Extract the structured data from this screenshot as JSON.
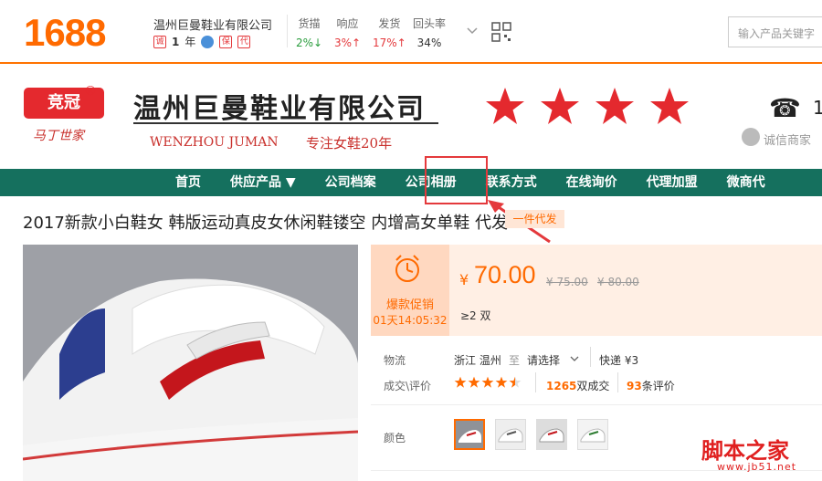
{
  "topbar": {
    "logo": "1688",
    "company": "温州巨曼鞋业有限公司",
    "years_num": "1",
    "years_unit": "年",
    "stats": [
      {
        "label": "货描",
        "value": "2%↓",
        "color": "green"
      },
      {
        "label": "响应",
        "value": "3%↑",
        "color": "red"
      },
      {
        "label": "发货",
        "value": "17%↑",
        "color": "red"
      },
      {
        "label": "回头率",
        "value": "34%",
        "color": "dark"
      }
    ],
    "search_placeholder": "输入产品关键字"
  },
  "banner": {
    "brand_logo": "竞冠",
    "brand_reg": "®",
    "brand_sub": "马丁世家",
    "shop_name": "温州巨曼鞋业有限公司",
    "shop_en": "WENZHOU  JUMAN",
    "shop_tagline": "专注女鞋20年",
    "phone_fragment": "1",
    "credit_label": "诚信商家",
    "star_count": 4
  },
  "nav": {
    "items": [
      "首页",
      "供应产品 ▼",
      "公司档案",
      "公司相册",
      "联系方式",
      "在线询价",
      "代理加盟",
      "微商代"
    ]
  },
  "product": {
    "title": "2017新款小白鞋女 韩版运动真皮女休闲鞋镂空 内增高女单鞋 代发",
    "tag": "一件代发",
    "promo_label": "爆款促销",
    "promo_time": "01天14:05:32",
    "currency": "¥",
    "price": "70.00",
    "old_price_1": "¥ 75.00",
    "old_price_2": "¥ 80.00",
    "moq": "≥2 双",
    "logistics_label": "物流",
    "logistics_from": "浙江 温州",
    "logistics_to_word": "至",
    "logistics_dest": "请选择",
    "logistics_fee": "快递 ¥3",
    "deal_label": "成交\\评价",
    "deal_count": "1265",
    "deal_suffix": "双成交",
    "review_count": "93",
    "review_suffix": "条评价",
    "rating": 4.5,
    "color_label": "颜色"
  },
  "watermark": {
    "text": "脚本之家",
    "url": "www.jb51.net"
  }
}
